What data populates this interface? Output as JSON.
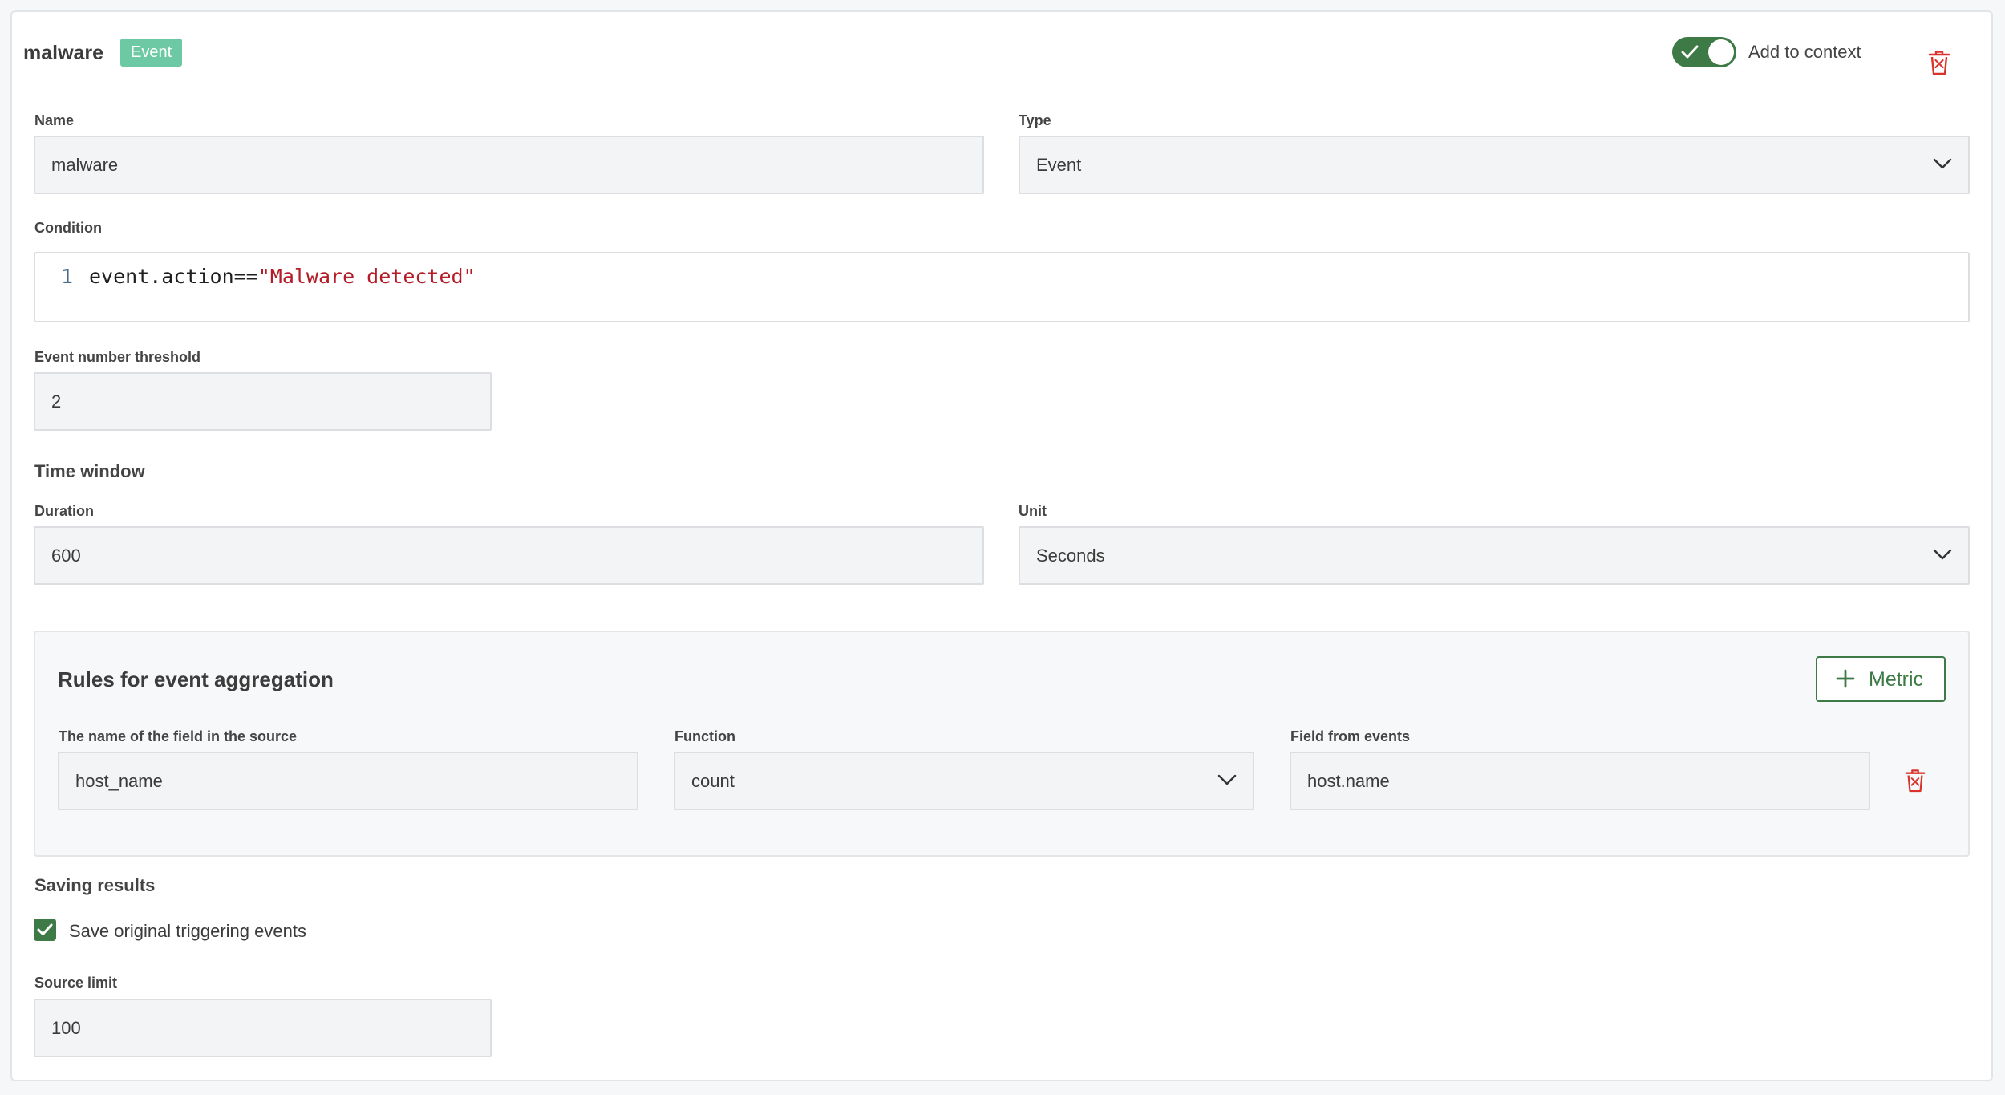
{
  "header": {
    "title": "malware",
    "badge": "Event",
    "toggle_label": "Add to context"
  },
  "name_field": {
    "label": "Name",
    "value": "malware"
  },
  "type_field": {
    "label": "Type",
    "value": "Event"
  },
  "condition": {
    "label": "Condition",
    "line_number": "1",
    "code_prefix": "event.action==",
    "code_string": "\"Malware detected\""
  },
  "threshold": {
    "label": "Event number threshold",
    "value": "2"
  },
  "time_window": {
    "title": "Time window",
    "duration_label": "Duration",
    "duration_value": "600",
    "unit_label": "Unit",
    "unit_value": "Seconds"
  },
  "aggregation": {
    "title": "Rules for event aggregation",
    "add_button": "Metric",
    "source_field_label": "The name of the field in the source",
    "source_field_value": "host_name",
    "function_label": "Function",
    "function_value": "count",
    "events_field_label": "Field from events",
    "events_field_value": "host.name"
  },
  "saving": {
    "title": "Saving results",
    "checkbox_label": "Save original triggering events",
    "source_limit_label": "Source limit",
    "source_limit_value": "100"
  },
  "icons": {
    "toggle": "check-icon",
    "delete": "trash-icon",
    "select": "chevron-down-icon",
    "add": "plus-icon",
    "checkbox": "check-icon"
  },
  "colors": {
    "accent": "#3d7a45",
    "badge": "#6cc9a3",
    "danger": "#d9342b",
    "code_string": "#b31d28"
  },
  "state": {
    "add_to_context": true,
    "save_original_events": true
  }
}
